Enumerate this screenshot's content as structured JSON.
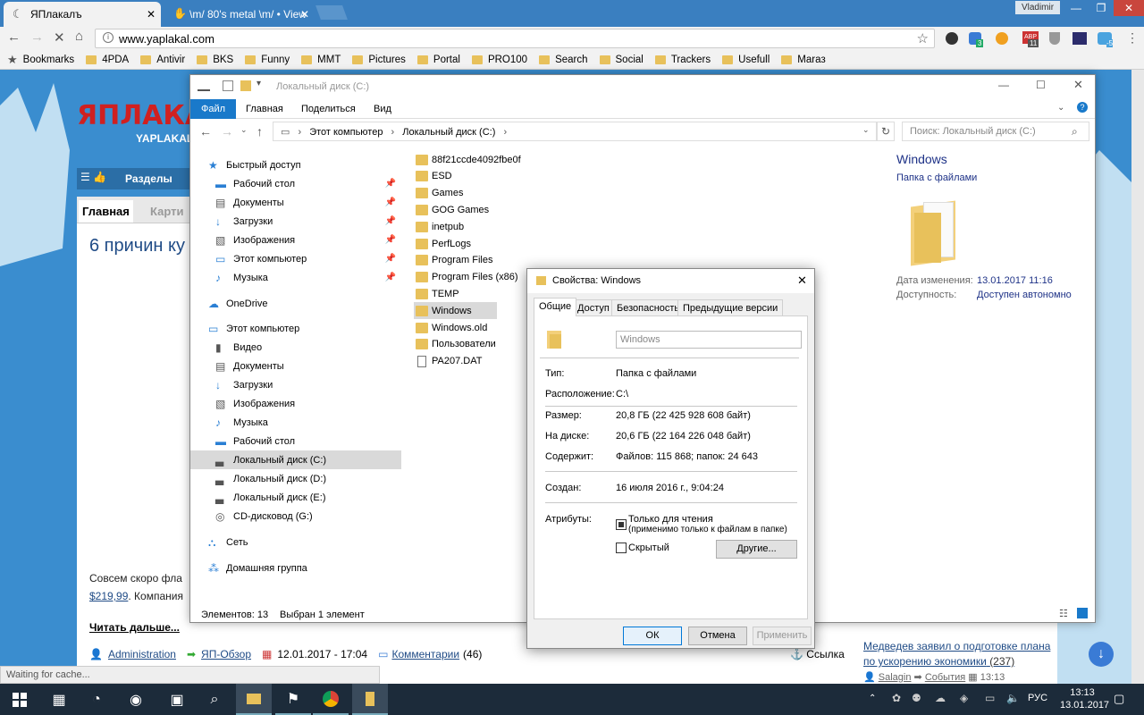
{
  "browser": {
    "tabs": [
      {
        "title": "ЯПлакалъ",
        "active": true
      },
      {
        "title": "\\m/ 80's metal \\m/ • View",
        "active": false
      }
    ],
    "user": "Vladimir",
    "url": "www.yaplakal.com",
    "bookmarks_label": "Bookmarks",
    "bookmarks": [
      "4PDA",
      "Antivir",
      "BKS",
      "Funny",
      "MMT",
      "Pictures",
      "Portal",
      "PRO100",
      "Search",
      "Social",
      "Trackers",
      "Usefull",
      "Maraз"
    ],
    "status_text": "Waiting for cache...",
    "ext_badges": [
      "3",
      "ABP",
      "11",
      "-5"
    ]
  },
  "site": {
    "logo": "ЯПЛАКАЛ",
    "logo_sub": "YAPLAKAL",
    "sections_label": "Разделы",
    "tab_main": "Главная",
    "tab_other": "Карти",
    "heading": "6 причин ку",
    "body_text": "Совсем скоро фла",
    "price": "$219,99",
    "body_text2": ". Компания",
    "read_more": "Читать дальше...",
    "author": "Administration",
    "category": "ЯП-Обзор",
    "date": "12.01.2017 - 17:04",
    "comments_label": "Комментарии",
    "comments_count": "(46)",
    "link_label": "Ссылка",
    "news_title": "Медведев заявил о подготовке плана по ускорению экономики",
    "news_count": "(237)",
    "news_author": "Salagin",
    "news_cat": "События",
    "news_time": "13:13"
  },
  "explorer": {
    "title": "Локальный диск (C:)",
    "ribbon_tabs": [
      "Файл",
      "Главная",
      "Поделиться",
      "Вид"
    ],
    "breadcrumb": [
      "Этот компьютер",
      "Локальный диск (C:)"
    ],
    "search_placeholder": "Поиск: Локальный диск (C:)",
    "nav": [
      {
        "label": "Быстрый доступ",
        "type": "quick"
      },
      {
        "label": "Рабочий стол",
        "type": "desktop",
        "pinned": true
      },
      {
        "label": "Документы",
        "type": "docs",
        "pinned": true
      },
      {
        "label": "Загрузки",
        "type": "downloads",
        "pinned": true
      },
      {
        "label": "Изображения",
        "type": "pictures",
        "pinned": true
      },
      {
        "label": "Этот компьютер",
        "type": "pc",
        "pinned": true
      },
      {
        "label": "Музыка",
        "type": "music",
        "pinned": true
      },
      {
        "label": "OneDrive",
        "type": "onedrive"
      },
      {
        "label": "Этот компьютер",
        "type": "pc"
      },
      {
        "label": "Видео",
        "type": "video"
      },
      {
        "label": "Документы",
        "type": "docs"
      },
      {
        "label": "Загрузки",
        "type": "downloads"
      },
      {
        "label": "Изображения",
        "type": "pictures"
      },
      {
        "label": "Музыка",
        "type": "music"
      },
      {
        "label": "Рабочий стол",
        "type": "desktop"
      },
      {
        "label": "Локальный диск (C:)",
        "type": "drive",
        "selected": true
      },
      {
        "label": "Локальный диск (D:)",
        "type": "drive"
      },
      {
        "label": "Локальный диск (E:)",
        "type": "drive"
      },
      {
        "label": "CD-дисковод (G:)",
        "type": "cd"
      },
      {
        "label": "Сеть",
        "type": "network"
      },
      {
        "label": "Домашняя группа",
        "type": "homegroup"
      }
    ],
    "files": [
      {
        "name": "88f21ccde4092fbe0f",
        "type": "folder"
      },
      {
        "name": "ESD",
        "type": "folder"
      },
      {
        "name": "Games",
        "type": "folder"
      },
      {
        "name": "GOG Games",
        "type": "folder"
      },
      {
        "name": "inetpub",
        "type": "folder"
      },
      {
        "name": "PerfLogs",
        "type": "folder"
      },
      {
        "name": "Program Files",
        "type": "folder"
      },
      {
        "name": "Program Files (x86)",
        "type": "folder"
      },
      {
        "name": "TEMP",
        "type": "folder"
      },
      {
        "name": "Windows",
        "type": "folder",
        "selected": true
      },
      {
        "name": "Windows.old",
        "type": "folder"
      },
      {
        "name": "Пользователи",
        "type": "folder"
      },
      {
        "name": "PA207.DAT",
        "type": "file"
      }
    ],
    "status_items": "Элементов: 13",
    "status_selected": "Выбран 1 элемент",
    "preview": {
      "name": "Windows",
      "type": "Папка с файлами",
      "modified_label": "Дата изменения:",
      "modified_value": "13.01.2017 11:16",
      "availability_label": "Доступность:",
      "availability_value": "Доступен автономно"
    }
  },
  "dialog": {
    "title": "Свойства: Windows",
    "tabs": [
      "Общие",
      "Доступ",
      "Безопасность",
      "Предыдущие версии"
    ],
    "name_value": "Windows",
    "type_label": "Тип:",
    "type_value": "Папка с файлами",
    "location_label": "Расположение:",
    "location_value": "C:\\",
    "size_label": "Размер:",
    "size_value": "20,8 ГБ (22 425 928 608 байт)",
    "disk_label": "На диске:",
    "disk_value": "20,6 ГБ (22 164 226 048 байт)",
    "contains_label": "Содержит:",
    "contains_value": "Файлов: 115 868; папок: 24 643",
    "created_label": "Создан:",
    "created_value": "16 июля 2016 г., 9:04:24",
    "attr_label": "Атрибуты:",
    "readonly_label": "Только для чтения",
    "readonly_sub": "(применимо только к файлам в папке)",
    "hidden_label": "Скрытый",
    "other_button": "Другие...",
    "ok": "ОК",
    "cancel": "Отмена",
    "apply": "Применить"
  },
  "taskbar": {
    "lang": "РУС",
    "time": "13:13",
    "date": "13.01.2017"
  }
}
